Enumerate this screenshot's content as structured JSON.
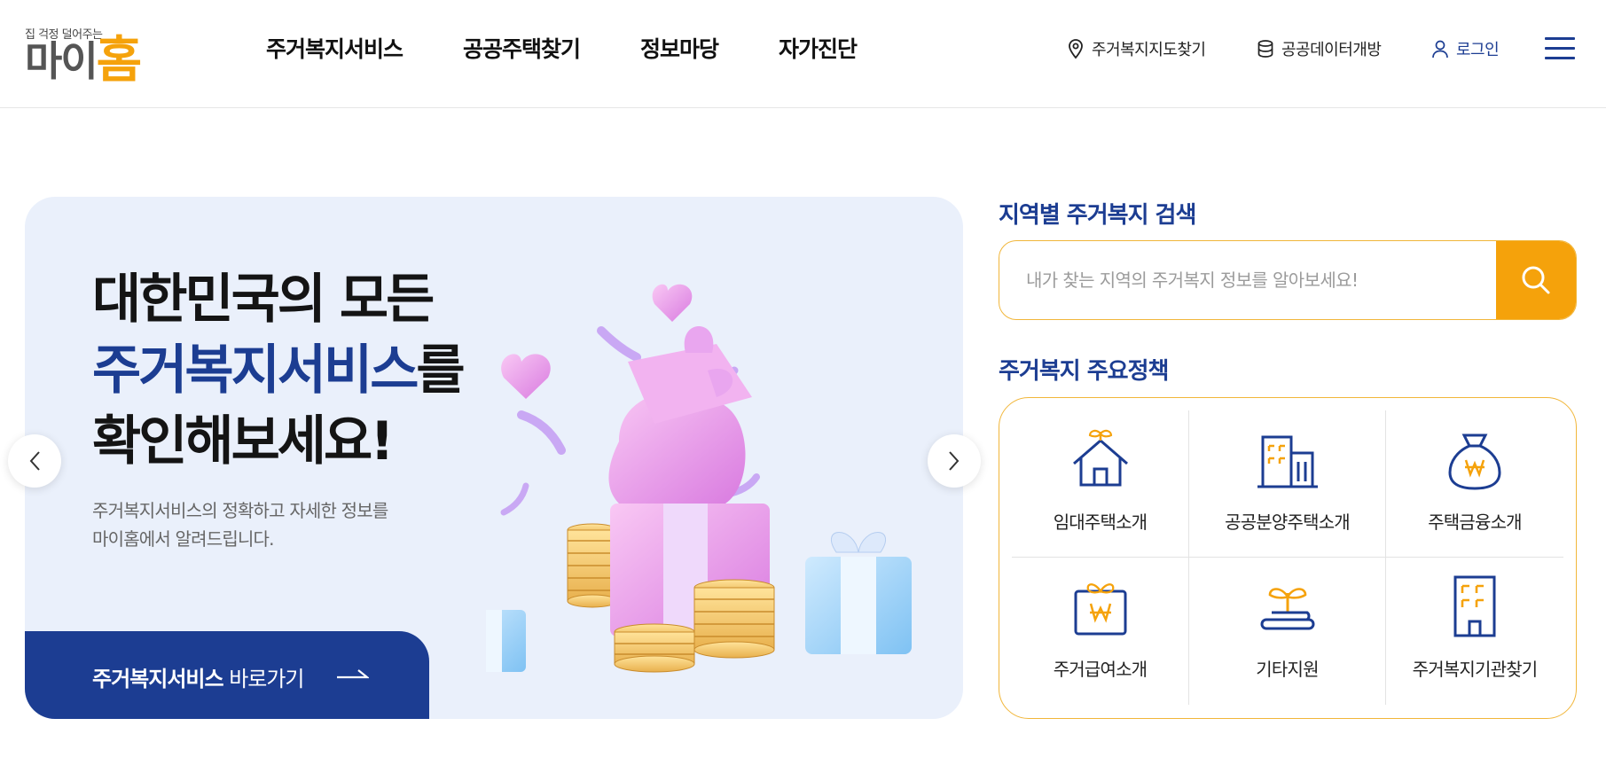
{
  "header": {
    "logo": {
      "tagline": "집 걱정 덜어주는",
      "name_prefix": "마이",
      "name_accent": "홈"
    },
    "nav": [
      "주거복지서비스",
      "공공주택찾기",
      "정보마당",
      "자가진단"
    ],
    "utilities": {
      "map_label": "주거복지지도찾기",
      "data_label": "공공데이터개방",
      "login_label": "로그인"
    },
    "menu_icon": "hamburger-icon"
  },
  "hero": {
    "title_line1": "대한민국의 모든",
    "title_line2_blue": "주거복지서비스",
    "title_line2_rest": "를",
    "title_line3": "확인해보세요!",
    "desc_line1": "주거복지서비스의 정확하고 자세한 정보를",
    "desc_line2": "마이홈에서 알려드립니다.",
    "cta_bold": "주거복지서비스",
    "cta_rest": " 바로가기",
    "prev_icon": "chevron-left-icon",
    "next_icon": "chevron-right-icon"
  },
  "search": {
    "title": "지역별 주거복지 검색",
    "placeholder": "내가 찾는 지역의 주거복지 정보를 알아보세요!",
    "value": "",
    "button_icon": "search-icon"
  },
  "policy": {
    "title": "주거복지 주요정책",
    "items": [
      {
        "label": "임대주택소개",
        "icon": "house-sprout-icon"
      },
      {
        "label": "공공분양주택소개",
        "icon": "apartment-buildings-icon"
      },
      {
        "label": "주택금융소개",
        "icon": "money-bag-icon"
      },
      {
        "label": "주거급여소개",
        "icon": "gift-won-icon"
      },
      {
        "label": "기타지원",
        "icon": "sprout-icon"
      },
      {
        "label": "주거복지기관찾기",
        "icon": "building-icon"
      }
    ]
  },
  "colors": {
    "primary_blue": "#1c3d92",
    "accent_orange": "#f5a20b",
    "hero_bg": "#eaf0fb",
    "border_gold": "#f1b63a"
  }
}
